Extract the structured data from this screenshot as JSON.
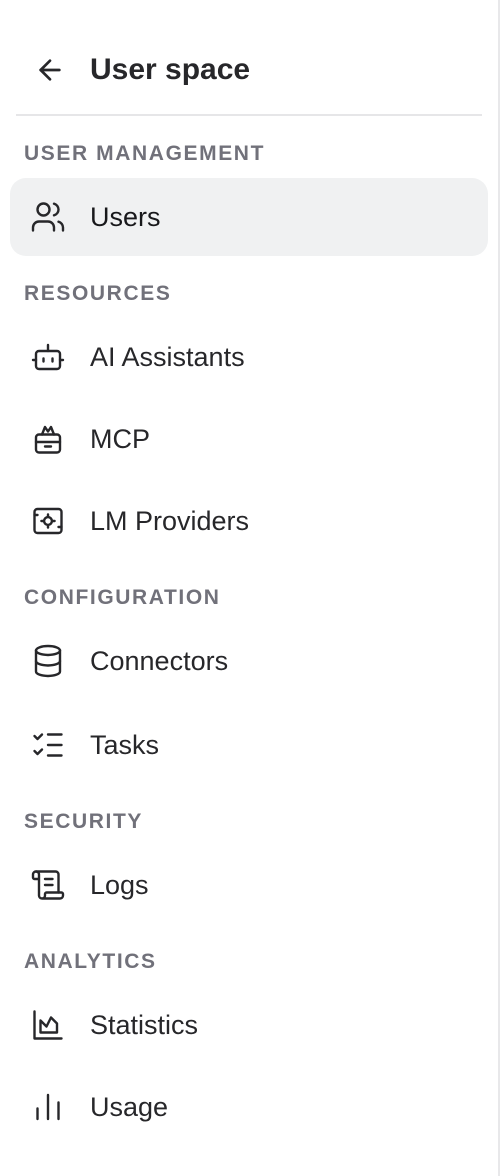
{
  "header": {
    "title": "User space",
    "back_icon": "arrow-left-icon"
  },
  "sections": [
    {
      "label": "USER MANAGEMENT",
      "items": [
        {
          "label": "Users",
          "icon": "users-icon",
          "active": true
        }
      ]
    },
    {
      "label": "RESOURCES",
      "items": [
        {
          "label": "AI Assistants",
          "icon": "bot-icon",
          "active": false
        },
        {
          "label": "MCP",
          "icon": "package-icon",
          "active": false
        },
        {
          "label": "LM Providers",
          "icon": "cpu-settings-icon",
          "active": false
        }
      ]
    },
    {
      "label": "CONFIGURATION",
      "items": [
        {
          "label": "Connectors",
          "icon": "database-icon",
          "active": false
        },
        {
          "label": "Tasks",
          "icon": "list-checks-icon",
          "active": false
        }
      ]
    },
    {
      "label": "SECURITY",
      "items": [
        {
          "label": "Logs",
          "icon": "scroll-icon",
          "active": false
        }
      ]
    },
    {
      "label": "ANALYTICS",
      "items": [
        {
          "label": "Statistics",
          "icon": "chart-area-icon",
          "active": false
        },
        {
          "label": "Usage",
          "icon": "bar-chart-icon",
          "active": false
        }
      ]
    }
  ],
  "colors": {
    "text": "#27272a",
    "section_label": "#71717a",
    "active_background": "#f0f1f2",
    "divider": "#e6e6e8"
  }
}
